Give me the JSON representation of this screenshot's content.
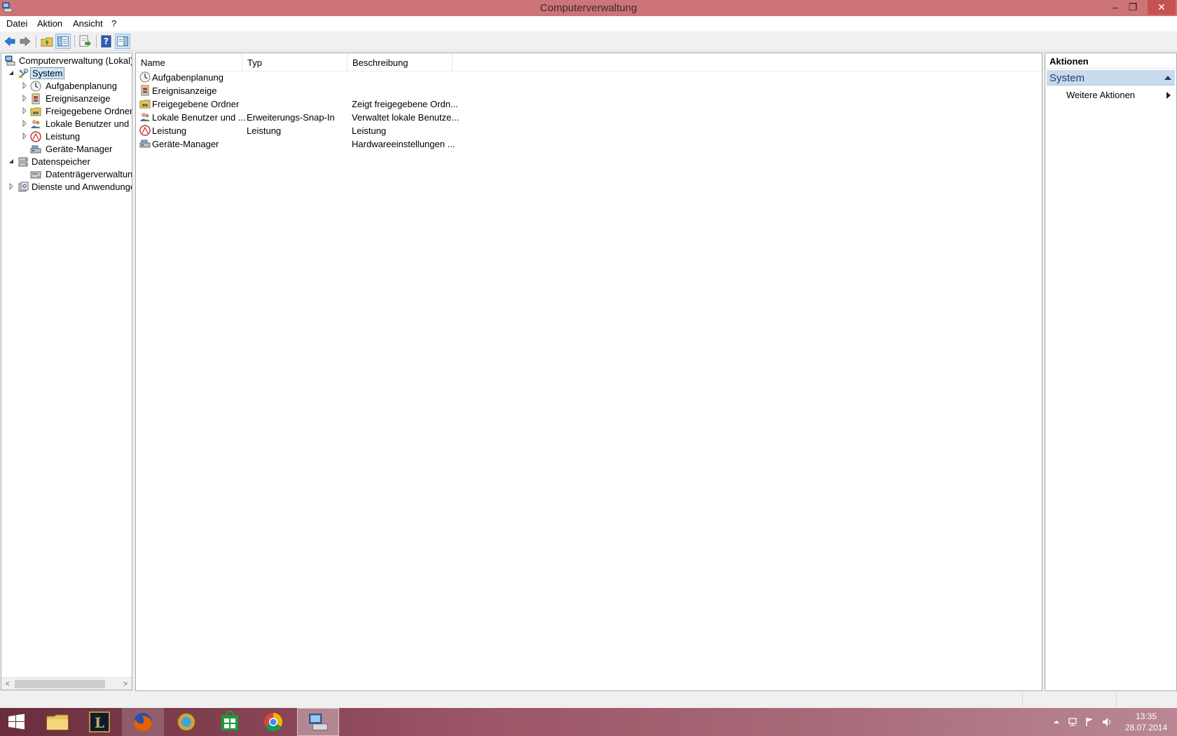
{
  "window": {
    "title": "Computerverwaltung",
    "controls": {
      "minimize": "–",
      "maximize": "❐",
      "close": "✕"
    }
  },
  "menu": [
    "Datei",
    "Aktion",
    "Ansicht",
    "?"
  ],
  "toolbar": {
    "buttons": [
      "back-icon",
      "forward-icon",
      "up-folder-icon",
      "show-hide-tree-icon",
      "export-list-icon",
      "help-icon",
      "show-hide-action-pane-icon"
    ]
  },
  "tree": {
    "root": "Computerverwaltung (Lokal)",
    "system": "System",
    "system_children": [
      "Aufgabenplanung",
      "Ereignisanzeige",
      "Freigegebene Ordner",
      "Lokale Benutzer und Gr",
      "Leistung",
      "Geräte-Manager"
    ],
    "storage": "Datenspeicher",
    "storage_children": [
      "Datenträgerverwaltung"
    ],
    "services": "Dienste und Anwendungen",
    "scroll_left": "<",
    "scroll_right": ">"
  },
  "list": {
    "columns": [
      "Name",
      "Typ",
      "Beschreibung"
    ],
    "rows": [
      {
        "name": "Aufgabenplanung",
        "type": "",
        "description": ""
      },
      {
        "name": "Ereignisanzeige",
        "type": "",
        "description": ""
      },
      {
        "name": "Freigegebene Ordner",
        "type": "",
        "description": "Zeigt freigegebene Ordn..."
      },
      {
        "name": "Lokale Benutzer und ...",
        "type": "Erweiterungs-Snap-In",
        "description": "Verwaltet lokale Benutze..."
      },
      {
        "name": "Leistung",
        "type": "Leistung",
        "description": "Leistung"
      },
      {
        "name": "Geräte-Manager",
        "type": "",
        "description": "Hardwareeinstellungen ..."
      }
    ]
  },
  "actions": {
    "header": "Aktionen",
    "section": "System",
    "items": [
      "Weitere Aktionen"
    ]
  },
  "taskbar": {
    "apps": [
      "windows-start",
      "file-explorer",
      "league-of-legends",
      "firefox",
      "hearthstone",
      "windows-store",
      "chrome",
      "computer-management"
    ],
    "clock_time": "13:35",
    "clock_date": "28.07.2014"
  },
  "colors": {
    "titlebar": "#cc7477",
    "selection": "#cde8ff",
    "action_section": "#c8dcee"
  }
}
